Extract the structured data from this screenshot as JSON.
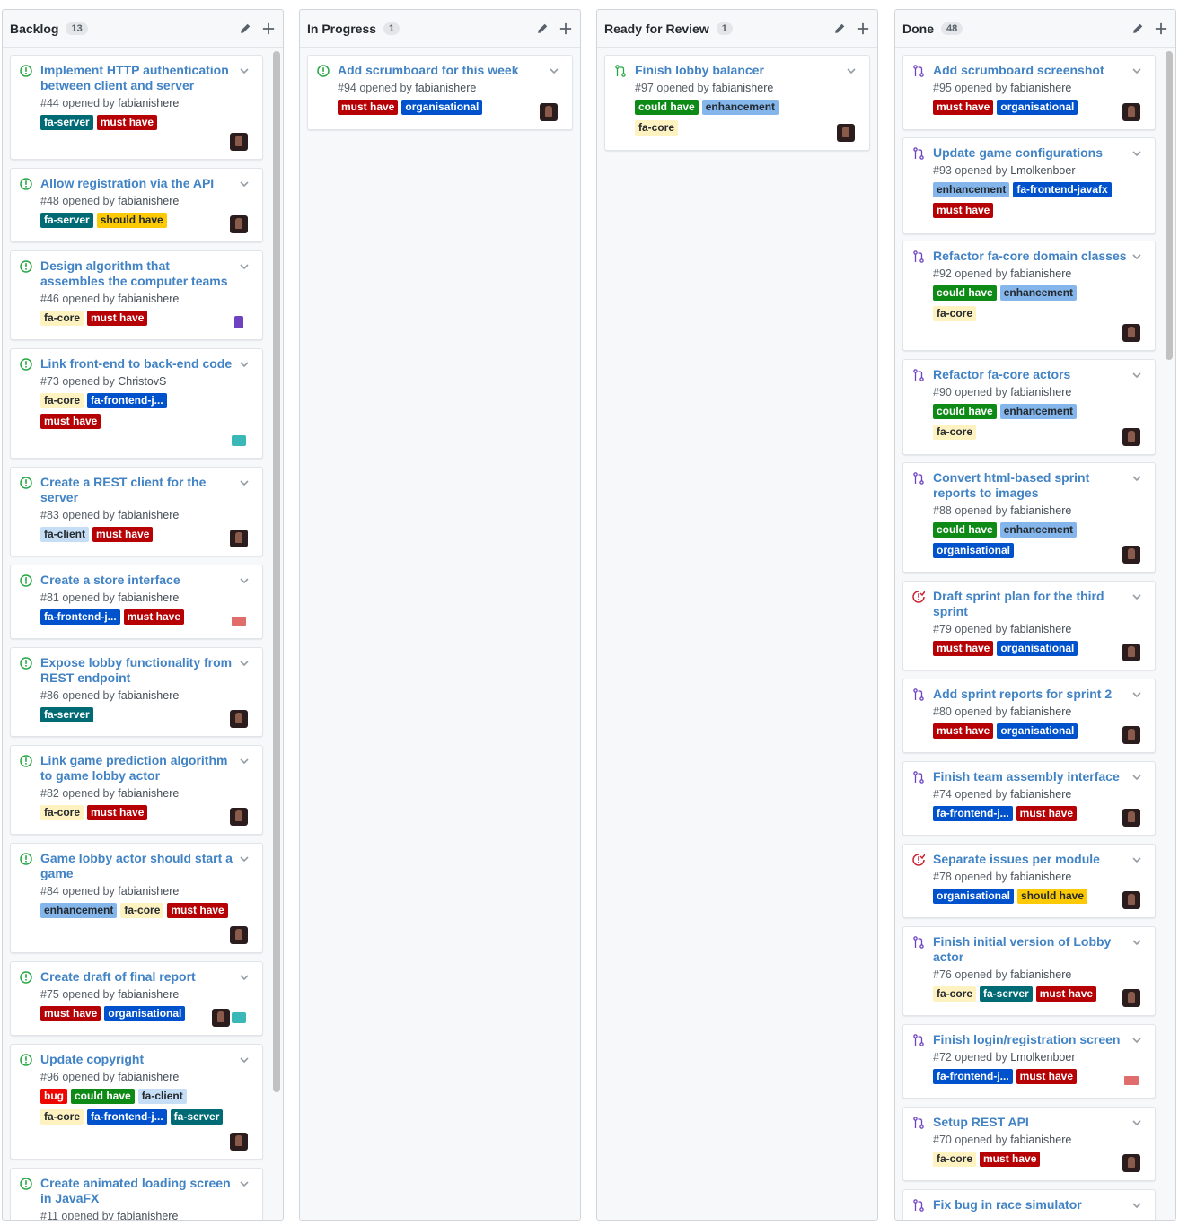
{
  "colors": {
    "open_issue": "#28a745",
    "pr_open": "#28a745",
    "pr_merged": "#6f42c1",
    "issue_closed": "#cb2431",
    "title_link": "#4183c4"
  },
  "labels": {
    "fa-server": {
      "text": "fa-server",
      "bg": "#006b75",
      "fg": "#ffffff"
    },
    "must have": {
      "text": "must have",
      "bg": "#b60205",
      "fg": "#ffffff"
    },
    "should have": {
      "text": "should have",
      "bg": "#fbca04",
      "fg": "#24292e"
    },
    "could have": {
      "text": "could have",
      "bg": "#0e8a16",
      "fg": "#ffffff"
    },
    "fa-core": {
      "text": "fa-core",
      "bg": "#fef2c0",
      "fg": "#24292e"
    },
    "fa-frontend-j...": {
      "text": "fa-frontend-j...",
      "bg": "#0052cc",
      "fg": "#ffffff"
    },
    "fa-frontend-javafx": {
      "text": "fa-frontend-javafx",
      "bg": "#0052cc",
      "fg": "#ffffff"
    },
    "fa-client": {
      "text": "fa-client",
      "bg": "#c5def5",
      "fg": "#24292e"
    },
    "enhancement": {
      "text": "enhancement",
      "bg": "#84b6eb",
      "fg": "#24292e"
    },
    "organisational": {
      "text": "organisational",
      "bg": "#0052cc",
      "fg": "#ffffff"
    },
    "bug": {
      "text": "bug",
      "bg": "#ee0701",
      "fg": "#ffffff"
    }
  },
  "columns": [
    {
      "title": "Backlog",
      "count": "13",
      "cards": [
        {
          "icon": "issue-open-icon",
          "title": "Implement HTTP authentication between client and server",
          "number": "#44",
          "opened_by": "opened by",
          "user": "fabianishere",
          "labels": [
            "fa-server",
            "must have"
          ],
          "avatar": "dark"
        },
        {
          "icon": "issue-open-icon",
          "title": "Allow registration via the API",
          "number": "#48",
          "opened_by": "opened by",
          "user": "fabianishere",
          "labels": [
            "fa-server",
            "should have"
          ],
          "avatar": "dark"
        },
        {
          "icon": "issue-open-icon",
          "title": "Design algorithm that assembles the computer teams",
          "number": "#46",
          "opened_by": "opened by",
          "user": "fabianishere",
          "labels": [
            "fa-core",
            "must have"
          ],
          "avatar": "purple"
        },
        {
          "icon": "issue-open-icon",
          "title": "Link front-end to back-end code",
          "number": "#73",
          "opened_by": "opened by",
          "user": "ChristovS",
          "labels": [
            "fa-core",
            "fa-frontend-j...",
            "must have"
          ],
          "avatar": "teal"
        },
        {
          "icon": "issue-open-icon",
          "title": "Create a REST client for the server",
          "number": "#83",
          "opened_by": "opened by",
          "user": "fabianishere",
          "labels": [
            "fa-client",
            "must have"
          ],
          "avatar": "dark"
        },
        {
          "icon": "issue-open-icon",
          "title": "Create a store interface",
          "number": "#81",
          "opened_by": "opened by",
          "user": "fabianishere",
          "labels": [
            "fa-frontend-j...",
            "must have"
          ],
          "avatar": "pink"
        },
        {
          "icon": "issue-open-icon",
          "title": "Expose lobby functionality from REST endpoint",
          "number": "#86",
          "opened_by": "opened by",
          "user": "fabianishere",
          "labels": [
            "fa-server"
          ],
          "avatar": "dark"
        },
        {
          "icon": "issue-open-icon",
          "title": "Link game prediction algorithm to game lobby actor",
          "number": "#82",
          "opened_by": "opened by",
          "user": "fabianishere",
          "labels": [
            "fa-core",
            "must have"
          ],
          "avatar": "dark"
        },
        {
          "icon": "issue-open-icon",
          "title": "Game lobby actor should start a game",
          "number": "#84",
          "opened_by": "opened by",
          "user": "fabianishere",
          "labels": [
            "enhancement",
            "fa-core",
            "must have"
          ],
          "avatar": "dark"
        },
        {
          "icon": "issue-open-icon",
          "title": "Create draft of final report",
          "number": "#75",
          "opened_by": "opened by",
          "user": "fabianishere",
          "labels": [
            "must have",
            "organisational"
          ],
          "avatar": "dark-teal"
        },
        {
          "icon": "issue-open-icon",
          "title": "Update copyright",
          "number": "#96",
          "opened_by": "opened by",
          "user": "fabianishere",
          "labels": [
            "bug",
            "could have",
            "fa-client",
            "fa-core",
            "fa-frontend-j...",
            "fa-server"
          ],
          "avatar": "dark"
        },
        {
          "icon": "issue-open-icon",
          "title": "Create animated loading screen in JavaFX",
          "number": "#11",
          "opened_by": "opened by",
          "user": "fabianishere",
          "labels": [],
          "avatar": ""
        }
      ]
    },
    {
      "title": "In Progress",
      "count": "1",
      "cards": [
        {
          "icon": "issue-open-icon",
          "title": "Add scrumboard for this week",
          "number": "#94",
          "opened_by": "opened by",
          "user": "fabianishere",
          "labels": [
            "must have",
            "organisational"
          ],
          "avatar": "dark"
        }
      ]
    },
    {
      "title": "Ready for Review",
      "count": "1",
      "cards": [
        {
          "icon": "pr-open-icon",
          "title": "Finish lobby balancer",
          "number": "#97",
          "opened_by": "opened by",
          "user": "fabianishere",
          "labels": [
            "could have",
            "enhancement",
            "fa-core"
          ],
          "avatar": "dark"
        }
      ]
    },
    {
      "title": "Done",
      "count": "48",
      "cards": [
        {
          "icon": "pr-merged-icon",
          "title": "Add scrumboard screenshot",
          "number": "#95",
          "opened_by": "opened by",
          "user": "fabianishere",
          "labels": [
            "must have",
            "organisational"
          ],
          "avatar": "dark"
        },
        {
          "icon": "pr-merged-icon",
          "title": "Update game configurations",
          "number": "#93",
          "opened_by": "opened by",
          "user": "Lmolkenboer",
          "labels": [
            "enhancement",
            "fa-frontend-javafx",
            "must have"
          ],
          "avatar": ""
        },
        {
          "icon": "pr-merged-icon",
          "title": "Refactor fa-core domain classes",
          "number": "#92",
          "opened_by": "opened by",
          "user": "fabianishere",
          "labels": [
            "could have",
            "enhancement",
            "fa-core"
          ],
          "avatar": "dark"
        },
        {
          "icon": "pr-merged-icon",
          "title": "Refactor fa-core actors",
          "number": "#90",
          "opened_by": "opened by",
          "user": "fabianishere",
          "labels": [
            "could have",
            "enhancement",
            "fa-core"
          ],
          "avatar": "dark"
        },
        {
          "icon": "pr-merged-icon",
          "title": "Convert html-based sprint reports to images",
          "number": "#88",
          "opened_by": "opened by",
          "user": "fabianishere",
          "labels": [
            "could have",
            "enhancement",
            "organisational"
          ],
          "avatar": "dark"
        },
        {
          "icon": "issue-closed-icon",
          "title": "Draft sprint plan for the third sprint",
          "number": "#79",
          "opened_by": "opened by",
          "user": "fabianishere",
          "labels": [
            "must have",
            "organisational"
          ],
          "avatar": "dark"
        },
        {
          "icon": "pr-merged-icon",
          "title": "Add sprint reports for sprint 2",
          "number": "#80",
          "opened_by": "opened by",
          "user": "fabianishere",
          "labels": [
            "must have",
            "organisational"
          ],
          "avatar": "dark"
        },
        {
          "icon": "pr-merged-icon",
          "title": "Finish team assembly interface",
          "number": "#74",
          "opened_by": "opened by",
          "user": "fabianishere",
          "labels": [
            "fa-frontend-j...",
            "must have"
          ],
          "avatar": "dark"
        },
        {
          "icon": "issue-closed-icon",
          "title": "Separate issues per module",
          "number": "#78",
          "opened_by": "opened by",
          "user": "fabianishere",
          "labels": [
            "organisational",
            "should have"
          ],
          "avatar": "dark"
        },
        {
          "icon": "pr-merged-icon",
          "title": "Finish initial version of Lobby actor",
          "number": "#76",
          "opened_by": "opened by",
          "user": "fabianishere",
          "labels": [
            "fa-core",
            "fa-server",
            "must have"
          ],
          "avatar": "dark"
        },
        {
          "icon": "pr-merged-icon",
          "title": "Finish login/registration screen",
          "number": "#72",
          "opened_by": "opened by",
          "user": "Lmolkenboer",
          "labels": [
            "fa-frontend-j...",
            "must have"
          ],
          "avatar": "pink"
        },
        {
          "icon": "pr-merged-icon",
          "title": "Setup REST API",
          "number": "#70",
          "opened_by": "opened by",
          "user": "fabianishere",
          "labels": [
            "fa-core",
            "must have"
          ],
          "avatar": "dark"
        },
        {
          "icon": "pr-merged-icon",
          "title": "Fix bug in race simulator",
          "number": "",
          "opened_by": "",
          "user": "",
          "labels": [],
          "avatar": ""
        }
      ]
    }
  ]
}
